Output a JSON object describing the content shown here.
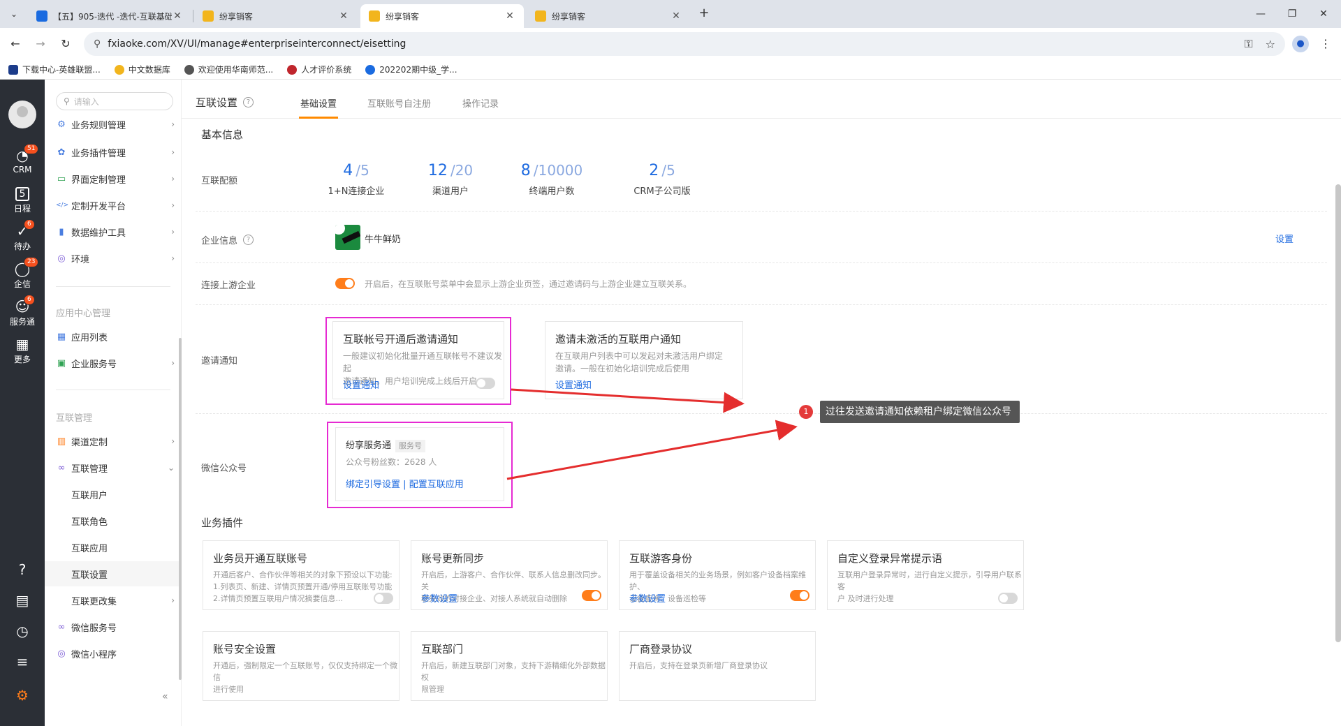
{
  "browser": {
    "tabs": [
      {
        "title": "【五】905-迭代 -迭代-互联基础",
        "active": false,
        "color": "#1a6be0"
      },
      {
        "title": "纷享销客",
        "active": false,
        "color": "#f2b51d"
      },
      {
        "title": "纷享销客",
        "active": true,
        "color": "#f2b51d"
      },
      {
        "title": "纷享销客",
        "active": false,
        "color": "#f2b51d"
      }
    ],
    "url": "fxiaoke.com/XV/UI/manage#enterpriseinterconnect/eisetting",
    "bookmarks": [
      {
        "label": "下载中心-英雄联盟...",
        "color": "#1c3c8a"
      },
      {
        "label": "中文数据库",
        "color": "#f2b51d"
      },
      {
        "label": "欢迎使用华南师范...",
        "color": "#555555"
      },
      {
        "label": "人才评价系统",
        "color": "#c0262d"
      },
      {
        "label": "202202期中级_学...",
        "color": "#1a6be0"
      }
    ]
  },
  "rail": {
    "items": [
      {
        "label": "CRM",
        "icon": "◔",
        "badge": "51"
      },
      {
        "label": "日程",
        "icon": "5",
        "badge": ""
      },
      {
        "label": "待办",
        "icon": "✓",
        "badge": "6"
      },
      {
        "label": "企信",
        "icon": "◯",
        "badge": "23"
      },
      {
        "label": "服务通",
        "icon": "☺",
        "badge": "6"
      },
      {
        "label": "更多",
        "icon": "▦",
        "badge": ""
      }
    ],
    "bottom_icons": [
      "?",
      "▤",
      "◷",
      "≡",
      "⚙"
    ]
  },
  "submenu": {
    "search_placeholder": "请输入",
    "items_top": [
      {
        "label": "业务规则管理",
        "icon": "⚙"
      },
      {
        "label": "业务插件管理",
        "icon": "✿"
      },
      {
        "label": "界面定制管理",
        "icon": "▭"
      },
      {
        "label": "定制开发平台",
        "icon": "</>"
      },
      {
        "label": "数据维护工具",
        "icon": "▮"
      },
      {
        "label": "环境",
        "icon": "◎"
      }
    ],
    "group_app": "应用中心管理",
    "items_app": [
      {
        "label": "应用列表",
        "icon": "▦"
      },
      {
        "label": "企业服务号",
        "icon": "▣"
      }
    ],
    "group_interconnect": "互联管理",
    "items_ic": [
      {
        "label": "渠道定制",
        "icon": "▥"
      },
      {
        "label": "互联管理",
        "icon": "∞"
      }
    ],
    "sub_items": [
      "互联用户",
      "互联角色",
      "互联应用",
      "互联设置",
      "互联更改集"
    ],
    "items_bottom": [
      {
        "label": "微信服务号",
        "icon": "∞"
      },
      {
        "label": "微信小程序",
        "icon": "◎"
      }
    ],
    "collapse": "«"
  },
  "header": {
    "title": "互联设置",
    "tabs": [
      "基础设置",
      "互联账号自注册",
      "操作记录"
    ]
  },
  "basic": {
    "section": "基本信息",
    "quota_label": "互联配额",
    "quotas": [
      {
        "used": "4",
        "total": "/5",
        "label": "1+N连接企业"
      },
      {
        "used": "12",
        "total": "/20",
        "label": "渠道用户"
      },
      {
        "used": "8",
        "total": "/10000",
        "label": "终端用户数"
      },
      {
        "used": "2",
        "total": "/5",
        "label": "CRM子公司版"
      }
    ],
    "company_label": "企业信息",
    "company_name": "牛牛鲜奶",
    "company_action": "设置",
    "upstream_label": "连接上游企业",
    "upstream_hint": "开启后，在互联账号菜单中会显示上游企业页签，通过邀请码与上游企业建立互联关系。",
    "invite_label": "邀请通知",
    "invite_cards": [
      {
        "title": "互联帐号开通后邀请通知",
        "desc1": "一般建议初始化批量开通互联帐号不建议发起",
        "desc2": "邀请通知。用户培训完成上线后开启",
        "link": "设置通知"
      },
      {
        "title": "邀请未激活的互联用户通知",
        "desc1": "在互联用户列表中可以发起对未激活用户绑定",
        "desc2": "邀请。一般在初始化培训完成后使用",
        "link": "设置通知"
      }
    ],
    "wechat_label": "微信公众号",
    "wechat_card": {
      "name": "纷享服务通",
      "tag": "服务号",
      "fans": "公众号粉丝数：2628 人",
      "link1": "绑定引导设置",
      "sep": "|",
      "link2": "配置互联应用"
    }
  },
  "annotation": {
    "num": "1",
    "text": "过往发送邀请通知依赖租户绑定微信公众号",
    "color": "#e43a3a"
  },
  "plugins": {
    "section": "业务插件",
    "cards": [
      {
        "title": "业务员开通互联账号",
        "desc": [
          "开通后客户、合作伙伴等相关的对象下预设以下功能:",
          "1.列表页、新建、详情页预置开通/停用互联账号功能",
          "2.详情页预置互联用户情况摘要信息..."
        ],
        "link": "",
        "toggle": "off"
      },
      {
        "title": "账号更新同步",
        "desc": [
          "开启后，上游客户、合作伙伴、联系人信息删改同步。关",
          "联失效的对接企业、对接人系统就自动删除"
        ],
        "link": "参数设置",
        "toggle": "on"
      },
      {
        "title": "互联游客身份",
        "desc": [
          "用于覆盖设备相关的业务场景，例如客户设备档案维护、",
          "设备查询、设备巡检等"
        ],
        "link": "参数设置",
        "toggle": "on"
      },
      {
        "title": "自定义登录异常提示语",
        "desc": [
          "互联用户登录异常时，进行自定义提示，引导用户联系客",
          "户 及时进行处理"
        ],
        "link": "",
        "toggle": "off"
      },
      {
        "title": "账号安全设置",
        "desc": [
          "开通后，强制限定一个互联账号，仅仅支持绑定一个微信",
          "进行使用"
        ],
        "link": "",
        "toggle": ""
      },
      {
        "title": "互联部门",
        "desc": [
          "开启后，新建互联部门对象，支持下游精细化外部数据权",
          "限管理"
        ],
        "link": "",
        "toggle": ""
      },
      {
        "title": "厂商登录协议",
        "desc": [
          "开启后，支持在登录页新增厂商登录协议"
        ],
        "link": "",
        "toggle": ""
      }
    ]
  }
}
